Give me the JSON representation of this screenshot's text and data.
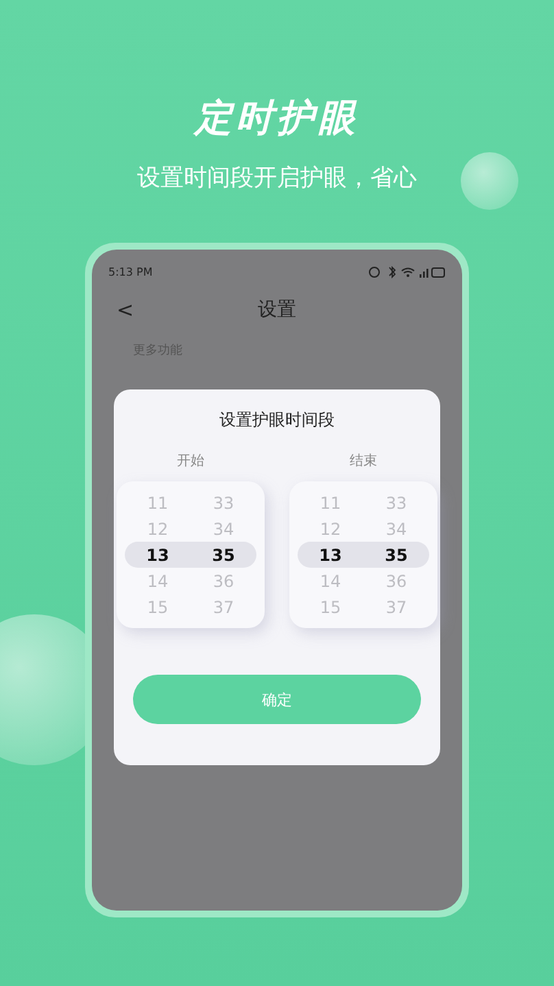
{
  "headline": "定时护眼",
  "subtitle": "设置时间段开启护眼，省心",
  "phone": {
    "status_time": "5:13 PM",
    "back": "<",
    "title": "设置",
    "section": "更多功能",
    "dialog": {
      "title": "设置护眼时间段",
      "pickers": [
        {
          "label": "开始",
          "rows": [
            {
              "hour": "11",
              "minute": "33",
              "selected": false
            },
            {
              "hour": "12",
              "minute": "34",
              "selected": false
            },
            {
              "hour": "13",
              "minute": "35",
              "selected": true
            },
            {
              "hour": "14",
              "minute": "36",
              "selected": false
            },
            {
              "hour": "15",
              "minute": "37",
              "selected": false
            }
          ]
        },
        {
          "label": "结束",
          "rows": [
            {
              "hour": "11",
              "minute": "33",
              "selected": false
            },
            {
              "hour": "12",
              "minute": "34",
              "selected": false
            },
            {
              "hour": "13",
              "minute": "35",
              "selected": true
            },
            {
              "hour": "14",
              "minute": "36",
              "selected": false
            },
            {
              "hour": "15",
              "minute": "37",
              "selected": false
            }
          ]
        }
      ],
      "confirm": "确定"
    }
  }
}
